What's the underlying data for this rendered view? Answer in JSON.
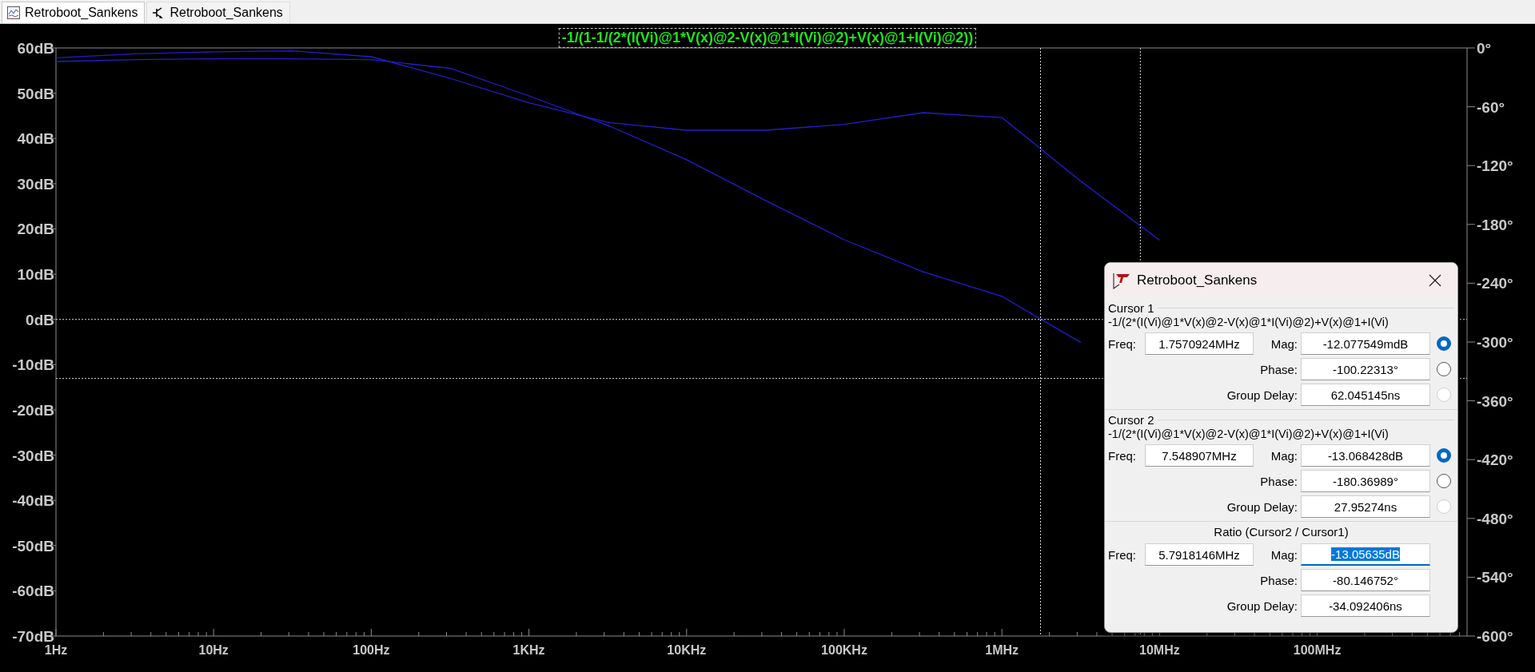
{
  "tabs": [
    {
      "label": "Retroboot_Sankens",
      "kind": "plot",
      "selected": true
    },
    {
      "label": "Retroboot_Sankens",
      "kind": "schematic",
      "selected": false
    }
  ],
  "plot": {
    "trace_label": "-1/(1-1/(2*(I(Vi)@1*V(x)@2-V(x)@1*I(Vi)@2)+V(x)@1+I(Vi)@2))",
    "chart_data": {
      "type": "line",
      "categories": [
        "1Hz",
        null,
        "10Hz",
        null,
        "100Hz",
        null,
        "1KHz",
        null,
        "10KHz",
        null,
        "100KHz",
        null,
        "1MHz",
        null,
        "10MHz",
        null,
        "100MHz",
        null
      ],
      "series": [
        {
          "color": "#2020c8",
          "values": [
            57.0,
            57.4,
            57.6,
            57.6,
            57.4,
            55.5,
            49.4,
            42.9,
            35.3,
            26.3,
            17.6,
            10.5,
            5.1,
            -5.1,
            null,
            null,
            null,
            null
          ]
        },
        {
          "color": "#2020c8",
          "axis": "y2",
          "values": [
            -10,
            -6,
            -4,
            -3,
            -9,
            -31,
            -56,
            -76,
            -84,
            -84,
            -78,
            -66,
            -71,
            -136,
            -196,
            null,
            null,
            null
          ]
        }
      ],
      "ylim": [
        -70,
        60
      ],
      "y2lim": [
        -600,
        0
      ],
      "yticks": [
        {
          "value": 60,
          "label": "60dB"
        },
        {
          "value": 50,
          "label": "50dB"
        },
        {
          "value": 40,
          "label": "40dB"
        },
        {
          "value": 30,
          "label": "30dB"
        },
        {
          "value": 20,
          "label": "20dB"
        },
        {
          "value": 10,
          "label": "10dB"
        },
        {
          "value": 0,
          "label": "0dB"
        },
        {
          "value": -10,
          "label": "-10dB"
        },
        {
          "value": -20,
          "label": "-20dB"
        },
        {
          "value": -30,
          "label": "-30dB"
        },
        {
          "value": -40,
          "label": "-40dB"
        },
        {
          "value": -50,
          "label": "-50dB"
        },
        {
          "value": -60,
          "label": "-60dB"
        },
        {
          "value": -70,
          "label": "-70dB"
        }
      ],
      "y2ticks": [
        {
          "value": 0,
          "label": "0°"
        },
        {
          "value": -60,
          "label": "-60°"
        },
        {
          "value": -120,
          "label": "-120°"
        },
        {
          "value": -180,
          "label": "-180°"
        },
        {
          "value": -240,
          "label": "-240°"
        },
        {
          "value": -300,
          "label": "-300°"
        },
        {
          "value": -360,
          "label": "-360°"
        },
        {
          "value": -420,
          "label": "-420°"
        },
        {
          "value": -480,
          "label": "-480°"
        },
        {
          "value": -540,
          "label": "-540°"
        },
        {
          "value": -600,
          "label": "-600°"
        }
      ],
      "ref_lines": [
        {
          "axis": "y",
          "value": -0.012
        },
        {
          "axis": "y",
          "value": -13.068
        }
      ]
    }
  },
  "dialog": {
    "title": "Retroboot_Sankens",
    "cursors": [
      {
        "title": "Cursor 1",
        "expression": "-1/(2*(I(Vi)@1*V(x)@2-V(x)@1*I(Vi)@2)+V(x)@1+I(Vi)",
        "freq_label": "Freq:",
        "freq": "1.7570924MHz",
        "measures": [
          {
            "label": "Mag:",
            "value": "-12.077549mdB",
            "selected": true,
            "disabled": false
          },
          {
            "label": "Phase:",
            "value": "-100.22313°",
            "selected": false,
            "disabled": false
          },
          {
            "label": "Group Delay:",
            "value": "62.045145ns",
            "selected": false,
            "disabled": true
          }
        ]
      },
      {
        "title": "Cursor 2",
        "expression": "-1/(2*(I(Vi)@1*V(x)@2-V(x)@1*I(Vi)@2)+V(x)@1+I(Vi)",
        "freq_label": "Freq:",
        "freq": "7.548907MHz",
        "measures": [
          {
            "label": "Mag:",
            "value": "-13.068428dB",
            "selected": true,
            "disabled": false
          },
          {
            "label": "Phase:",
            "value": "-180.36989°",
            "selected": false,
            "disabled": false
          },
          {
            "label": "Group Delay:",
            "value": "27.95274ns",
            "selected": false,
            "disabled": true
          }
        ]
      }
    ],
    "ratio": {
      "title": "Ratio (Cursor2 / Cursor1)",
      "freq_label": "Freq:",
      "freq": "5.7918146MHz",
      "measures": [
        {
          "label": "Mag:",
          "value": "-13.05635dB",
          "focused": true
        },
        {
          "label": "Phase:",
          "value": "-80.146752°",
          "focused": false
        },
        {
          "label": "Group Delay:",
          "value": "-34.092406ns",
          "focused": false
        }
      ]
    }
  }
}
